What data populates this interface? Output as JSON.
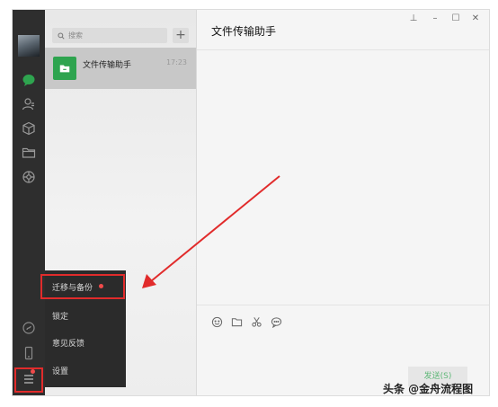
{
  "search": {
    "placeholder": "搜索"
  },
  "list": {
    "add_label": "+",
    "sessions": [
      {
        "name": "文件传输助手",
        "time": "17:23"
      }
    ]
  },
  "chat": {
    "title": "文件传输助手",
    "send_label": "发送(S)"
  },
  "menu": {
    "items": [
      {
        "label": "迁移与备份"
      },
      {
        "label": "锁定"
      },
      {
        "label": "意见反馈"
      },
      {
        "label": "设置"
      }
    ]
  },
  "window_controls": {
    "pin": "⊥",
    "minimize": "–",
    "maximize": "☐",
    "close": "✕"
  },
  "watermark": "头条 @金舟流程图",
  "colors": {
    "accent": "#2ea44f",
    "highlight": "#e12b2b",
    "badge": "#f04a4a",
    "rail": "#2e2e2e"
  }
}
